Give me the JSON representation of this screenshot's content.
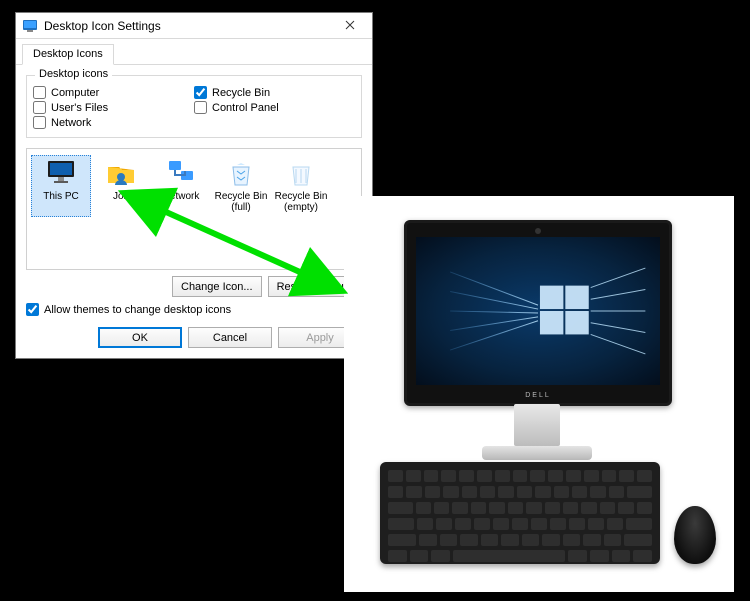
{
  "dialog": {
    "title": "Desktop Icon Settings",
    "tab": "Desktop Icons",
    "group_label": "Desktop icons",
    "checks": {
      "computer": {
        "label": "Computer",
        "checked": false
      },
      "users_files": {
        "label": "User's Files",
        "checked": false
      },
      "network": {
        "label": "Network",
        "checked": false
      },
      "recycle_bin": {
        "label": "Recycle Bin",
        "checked": true
      },
      "control_panel": {
        "label": "Control Panel",
        "checked": false
      }
    },
    "icons": {
      "this_pc": "This PC",
      "user": "Jon",
      "network": "Network",
      "rb_full": "Recycle Bin (full)",
      "rb_empty": "Recycle Bin (empty)"
    },
    "change_icon": "Change Icon...",
    "restore_default": "Restore Default",
    "allow_themes": {
      "label": "Allow themes to change desktop icons",
      "checked": true
    },
    "ok": "OK",
    "cancel": "Cancel",
    "apply": "Apply"
  },
  "photo": {
    "brand": "DELL"
  }
}
